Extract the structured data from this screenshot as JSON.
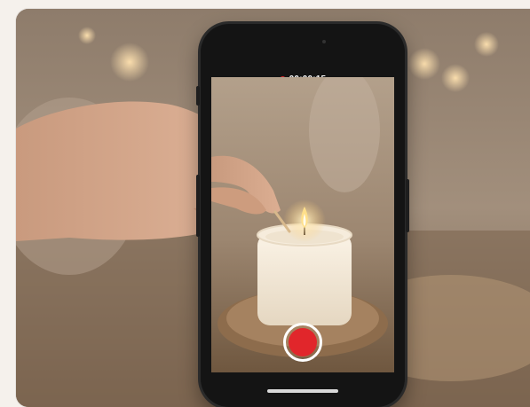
{
  "recording": {
    "indicator_color": "#e0262a",
    "timer": "00:00:15"
  },
  "record_button": {
    "color": "#e1262b",
    "ring_color": "#ffffff"
  },
  "scene": {
    "subject": "candle-lighting-photo"
  }
}
